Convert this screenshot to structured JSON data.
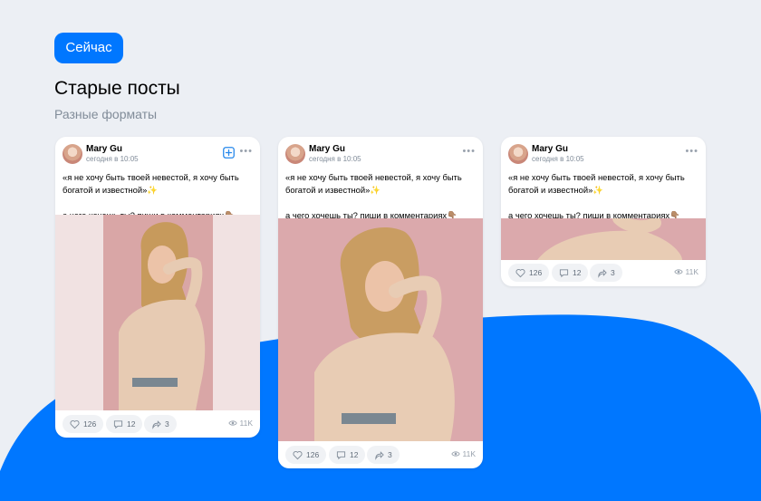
{
  "header": {
    "pill_label": "Сейчас",
    "title": "Старые посты",
    "subtitle": "Разные форматы"
  },
  "colors": {
    "accent": "#0077ff",
    "background": "#eceff4",
    "muted": "#818c99"
  },
  "posts": [
    {
      "author": "Mary Gu",
      "time": "сегодня в 10:05",
      "text_line1": "«я не хочу быть твоей невестой, я хочу быть богатой и известной»✨",
      "text_line2": "а чего хочешь ты? пиши в комментариях👇🏽",
      "likes": "126",
      "comments": "12",
      "reposts": "3",
      "views": "11K",
      "has_add_button": true
    },
    {
      "author": "Mary Gu",
      "time": "сегодня в 10:05",
      "text_line1": "«я не хочу быть твоей невестой, я хочу быть богатой и известной»✨",
      "text_line2": "а чего хочешь ты? пиши в комментариях👇🏽",
      "likes": "126",
      "comments": "12",
      "reposts": "3",
      "views": "11K"
    },
    {
      "author": "Mary Gu",
      "time": "сегодня в 10:05",
      "text_line1": "«я не хочу быть твоей невестой, я хочу быть богатой и известной»✨",
      "text_line2": "а чего хочешь ты? пиши в комментариях👇🏽",
      "likes": "126",
      "comments": "12",
      "reposts": "3",
      "views": "11K"
    }
  ]
}
